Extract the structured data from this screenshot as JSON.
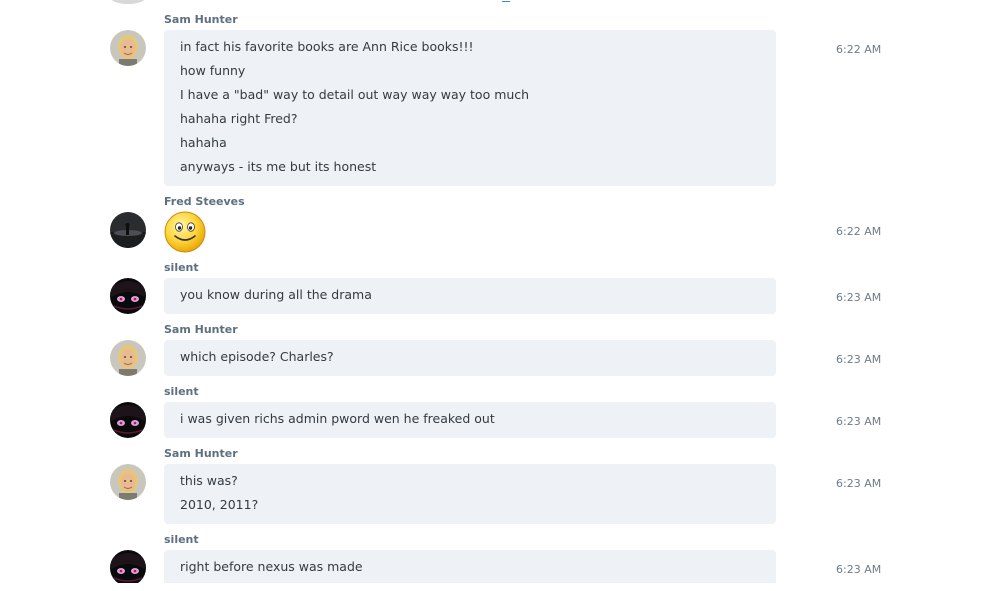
{
  "messages": [
    {
      "sender": "Sam Hunter",
      "avatar": "sam-avatar",
      "time": "6:22 AM",
      "lines": [
        "in fact his favorite books are Ann Rice books!!!",
        "how funny",
        "I have a \"bad\" way to detail out way way way too much",
        "hahaha right Fred?",
        "hahaha",
        "anyways  - its me but its honest"
      ]
    },
    {
      "sender": "Fred Steeves",
      "avatar": "fred-avatar",
      "time": "6:22 AM",
      "emoticon": "smile-emoticon"
    },
    {
      "sender": "silent",
      "avatar": "silent-avatar",
      "time": "6:23 AM",
      "lines": [
        "you know during all the drama"
      ]
    },
    {
      "sender": "Sam Hunter",
      "avatar": "sam-avatar",
      "time": "6:23 AM",
      "lines": [
        "which episode?  Charles?"
      ]
    },
    {
      "sender": "silent",
      "avatar": "silent-avatar",
      "time": "6:23 AM",
      "lines": [
        "i was given richs admin pword wen he freaked out"
      ]
    },
    {
      "sender": "Sam Hunter",
      "avatar": "sam-avatar",
      "time": "6:23 AM",
      "lines": [
        "this was?",
        "2010, 2011?"
      ]
    },
    {
      "sender": "silent",
      "avatar": "silent-avatar",
      "time": "6:23 AM",
      "lines": [
        "right before nexus was made"
      ]
    }
  ],
  "colors": {
    "bubble": "#eef1f6",
    "sender": "#5e6f80",
    "time": "#6f7b87",
    "text": "#333b42"
  }
}
